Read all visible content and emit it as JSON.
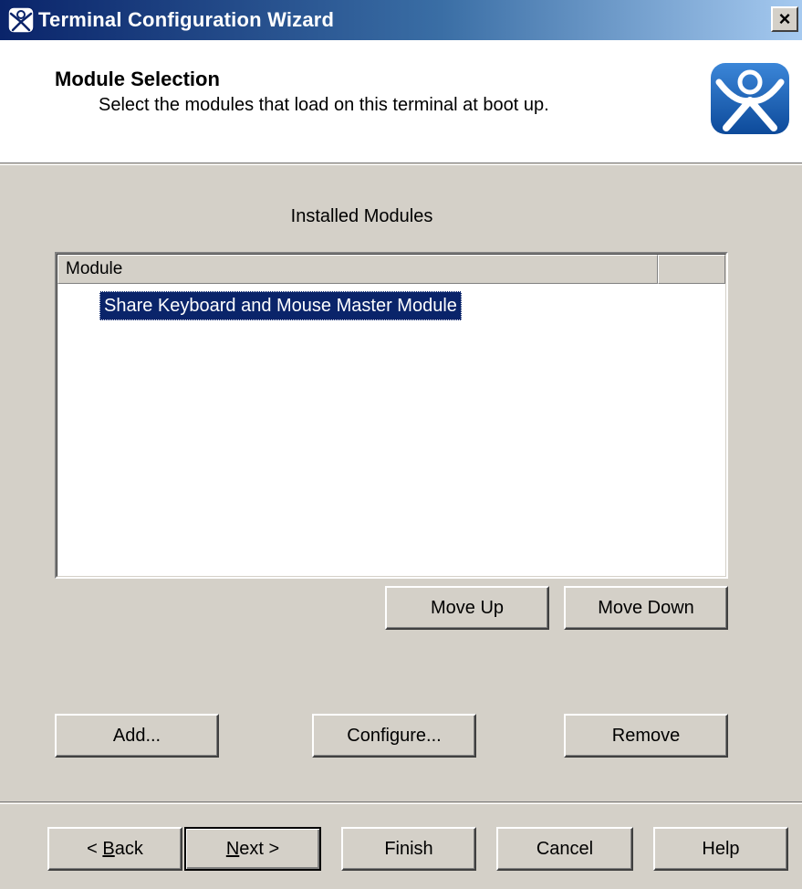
{
  "window": {
    "title": "Terminal Configuration Wizard",
    "close_label": "×"
  },
  "header": {
    "title": "Module Selection",
    "subtitle": "Select the modules that load on this terminal at boot up."
  },
  "modules": {
    "caption": "Installed Modules",
    "column_header": "Module",
    "items": [
      {
        "label": "Share Keyboard and Mouse Master Module",
        "selected": true
      }
    ]
  },
  "buttons": {
    "move_up": "Move Up",
    "move_down": "Move Down",
    "add": "Add...",
    "configure": "Configure...",
    "remove": "Remove"
  },
  "nav": {
    "back_prefix": "< ",
    "back_mnemonic": "B",
    "back_rest": "ack",
    "next_mnemonic": "N",
    "next_rest": "ext >",
    "finish": "Finish",
    "cancel": "Cancel",
    "help": "Help"
  },
  "colors": {
    "dialog_bg": "#d4d0c8",
    "selection": "#0a246a",
    "titlebar_start": "#0a246a",
    "logo_blue": "#1e5aa8"
  },
  "icons": {
    "window": "thinmanager-logo-icon",
    "header": "thinmanager-logo-icon"
  }
}
